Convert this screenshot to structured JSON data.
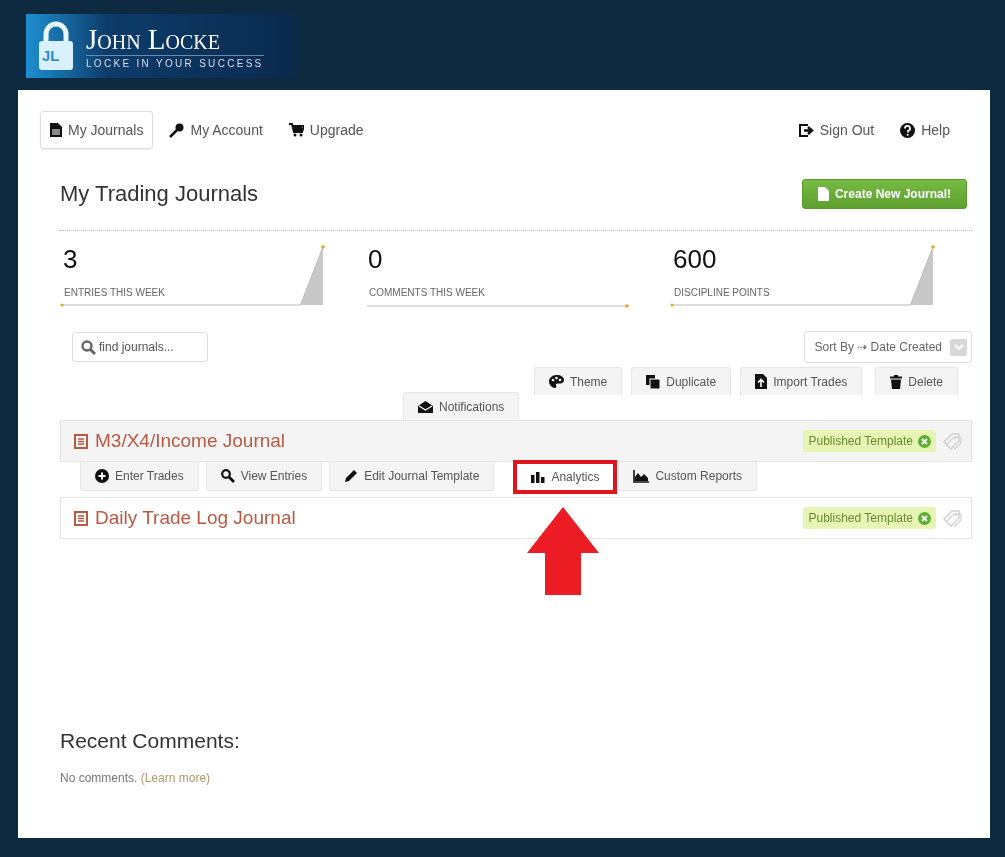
{
  "logo": {
    "title": "John Locke",
    "tagline": "LOCKE IN YOUR SUCCESS",
    "monogram": "JL"
  },
  "nav": {
    "left": [
      {
        "label": "My Journals",
        "selected": true
      },
      {
        "label": "My Account",
        "selected": false
      },
      {
        "label": "Upgrade",
        "selected": false
      }
    ],
    "right": [
      {
        "label": "Sign Out"
      },
      {
        "label": "Help"
      }
    ]
  },
  "page_title": "My Trading Journals",
  "create_button": "Create New Journal!",
  "stats": [
    {
      "value": "3",
      "label": "ENTRIES THIS WEEK",
      "kind": "rising"
    },
    {
      "value": "0",
      "label": "COMMENTS THIS WEEK",
      "kind": "flat"
    },
    {
      "value": "600",
      "label": "DISCIPLINE POINTS",
      "kind": "rising"
    }
  ],
  "search": {
    "placeholder": "find journals..."
  },
  "sort": {
    "value": "Sort By ⇢ Date Created"
  },
  "toolbar": [
    {
      "label": "Theme"
    },
    {
      "label": "Duplicate"
    },
    {
      "label": "Import Trades"
    },
    {
      "label": "Delete"
    },
    {
      "label": "Notifications"
    }
  ],
  "journals": [
    {
      "title": "M3/X4/Income Journal",
      "badge": "Published Template",
      "expanded": true,
      "actions": [
        {
          "label": "Enter Trades",
          "highlighted": false
        },
        {
          "label": "View Entries",
          "highlighted": false
        },
        {
          "label": "Edit Journal Template",
          "highlighted": false
        },
        {
          "label": "Analytics",
          "highlighted": true
        },
        {
          "label": "Custom Reports",
          "highlighted": false
        }
      ]
    },
    {
      "title": "Daily Trade Log Journal",
      "badge": "Published Template",
      "expanded": false
    }
  ],
  "recent_comments": {
    "title": "Recent Comments:",
    "text": "No comments.",
    "link": "(Learn more)"
  }
}
